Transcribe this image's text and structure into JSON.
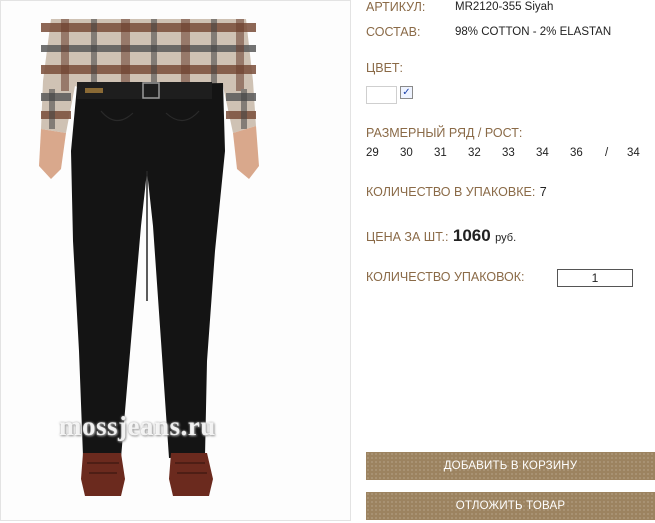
{
  "product": {
    "image_alt": "black jeans",
    "watermark": "mossjeans.ru",
    "sku_label": "АРТИКУЛ:",
    "sku_value": "MR2120-355 Siyah",
    "composition_label": "СОСТАВ:",
    "composition_value": "98% COTTON - 2% ELASTAN",
    "color_label": "ЦВЕТ:",
    "color_checked": "✓",
    "size_label": "РАЗМЕРНЫЙ РЯД / РОСТ:",
    "sizes": [
      "29",
      "30",
      "31",
      "32",
      "33",
      "34",
      "36",
      "/",
      "34"
    ],
    "pack_qty_label": "КОЛИЧЕСТВО В УПАКОВКЕ:",
    "pack_qty_value": "7",
    "price_label": "ЦЕНА ЗА ШТ.:",
    "price_value": "1060",
    "price_currency": "руб.",
    "packs_label": "КОЛИЧЕСТВО УПАКОВОК:",
    "packs_value": "1"
  },
  "actions": {
    "add_to_cart": "ДОБАВИТЬ В КОРЗИНУ",
    "postpone": "ОТЛОЖИТЬ ТОВАР"
  },
  "colors": {
    "label": "#8a6a47",
    "button": "#9c8360"
  }
}
